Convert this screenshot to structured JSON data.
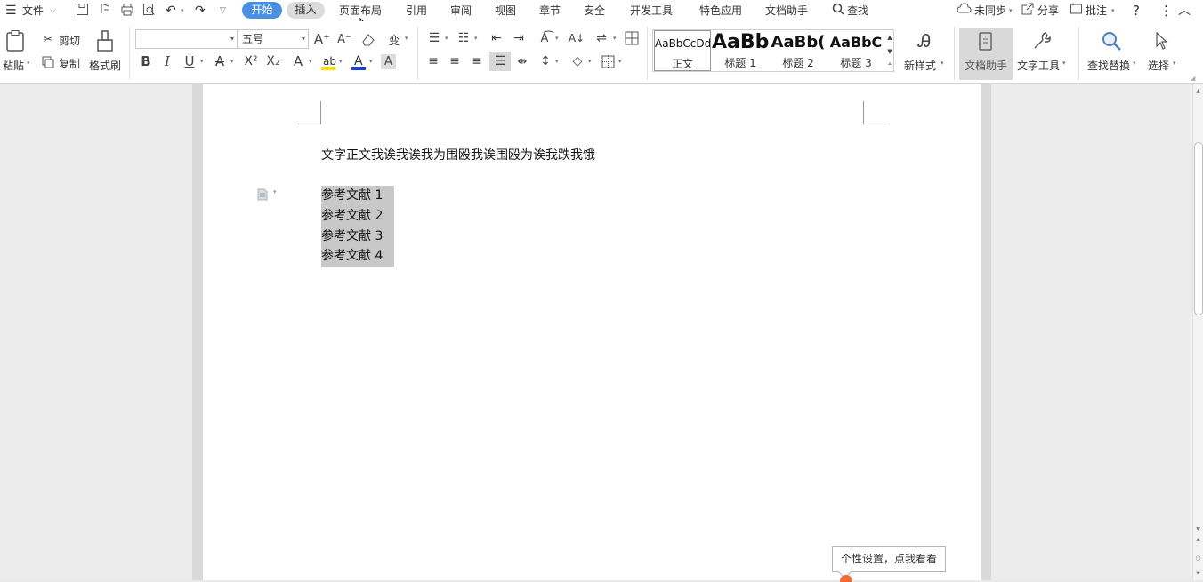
{
  "menu": {
    "file": "文件",
    "tabs": [
      "开始",
      "插入",
      "页面布局",
      "引用",
      "审阅",
      "视图",
      "章节",
      "安全",
      "开发工具",
      "特色应用",
      "文档助手"
    ],
    "search": "查找",
    "sync": "未同步",
    "share": "分享",
    "comment": "批注"
  },
  "ribbon": {
    "paste": "粘贴",
    "cut": "剪切",
    "copy": "复制",
    "format_painter": "格式刷",
    "font_name": "",
    "font_size": "五号",
    "styles": [
      {
        "preview": "AaBbCcDd",
        "name": "正文"
      },
      {
        "preview": "AaBb",
        "name": "标题 1"
      },
      {
        "preview": "AaBb(",
        "name": "标题 2"
      },
      {
        "preview": "AaBbC",
        "name": "标题 3"
      }
    ],
    "new_style": "新样式",
    "doc_assistant": "文档助手",
    "text_tools": "文字工具",
    "find_replace": "查找替换",
    "select": "选择"
  },
  "document": {
    "body_line": "文字正文我诶我诶我为围殴我诶围殴为诶我跌我饿",
    "references": [
      "参考文献 1",
      "参考文献 2",
      "参考文献 3",
      "参考文献 4"
    ]
  },
  "tooltip": "个性设置，点我看看",
  "colors": {
    "accent": "#4a90e2",
    "selection": "#c8c8c8"
  }
}
